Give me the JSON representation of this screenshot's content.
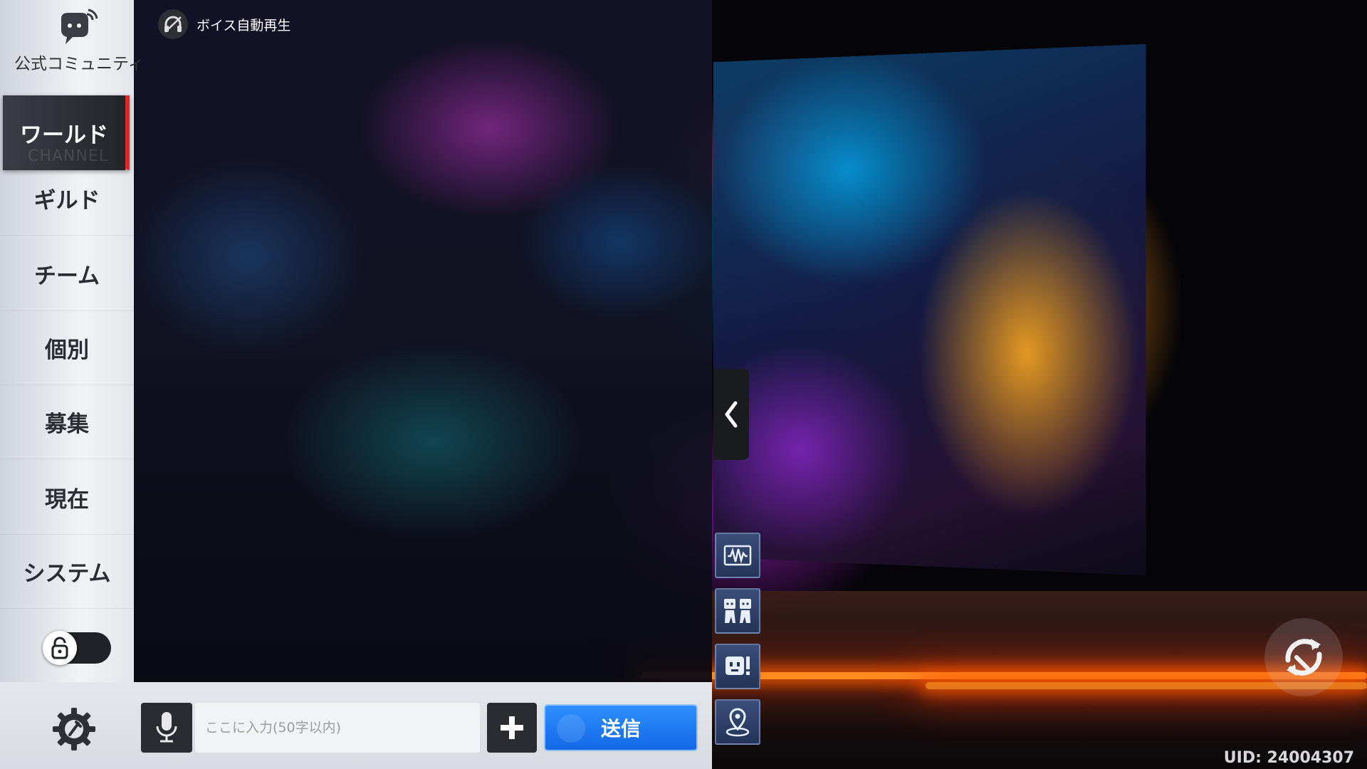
{
  "sidebar": {
    "community_label": "公式コミュニティ",
    "tabs": [
      {
        "label": "ワールド",
        "watermark": "CHANNEL"
      },
      {
        "label": "ギルド"
      },
      {
        "label": "チーム"
      },
      {
        "label": "個別"
      },
      {
        "label": "募集"
      },
      {
        "label": "現在"
      },
      {
        "label": "システム"
      }
    ],
    "lock_toggle_on": false
  },
  "chat": {
    "voice_autoplay_label": "ボイス自動再生"
  },
  "input": {
    "placeholder": "ここに入力(50字以内)",
    "send_label": "送信"
  },
  "quick_buttons": [
    "soundwave-icon",
    "two-characters-icon",
    "emote-icon",
    "location-pin-icon"
  ],
  "uid": "UID: 24004307",
  "colors": {
    "active_tab_accent": "#e0282a",
    "send_button": "#1b78f2"
  }
}
